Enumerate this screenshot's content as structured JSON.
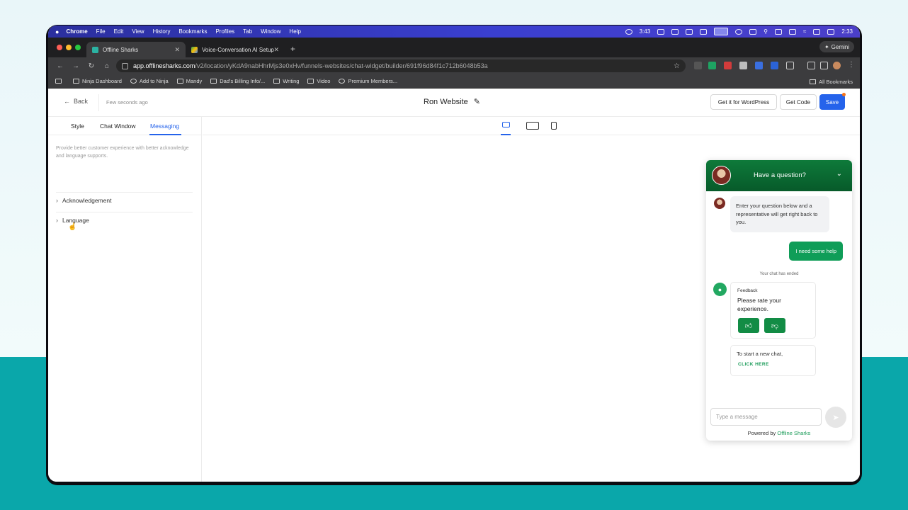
{
  "menubar": {
    "apple": "",
    "items": [
      "Chrome",
      "File",
      "Edit",
      "View",
      "History",
      "Bookmarks",
      "Profiles",
      "Tab",
      "Window",
      "Help"
    ],
    "timer": "3:43",
    "clock": "2:33"
  },
  "tabs": [
    {
      "title": "Offline Sharks",
      "active": true
    },
    {
      "title": "Voice-Conversation AI Setup",
      "active": false
    }
  ],
  "gemini_label": "Gemini",
  "address": {
    "host": "app.offlinesharks.com",
    "path": "/v2/location/yKdA9nabHhrMjs3e0xHv/funnels-websites/chat-widget/builder/691f96d84f1c712b6048b53a"
  },
  "bookmarks": [
    "Ninja Dashboard",
    "Add to Ninja",
    "Mandy",
    "Dad's Billing Info/...",
    "Writing",
    "Video",
    "Premium Members..."
  ],
  "all_bookmarks": "All Bookmarks",
  "header": {
    "back_label": "Back",
    "saved_status": "Few seconds ago",
    "site_name": "Ron Website",
    "wordpress_btn": "Get it for WordPress",
    "code_btn": "Get Code",
    "save_btn": "Save"
  },
  "sidebar": {
    "tabs": [
      "Style",
      "Chat Window",
      "Messaging"
    ],
    "active_tab": "Messaging",
    "description": "Provide better customer experience with better acknowledge and language supports.",
    "sections": [
      "Acknowledgement",
      "Language"
    ]
  },
  "widget": {
    "header_title": "Have a question?",
    "greeting": "Enter your question below and a representative will get right back to you.",
    "user_message": "I need some help",
    "ended_notice": "Your chat has ended",
    "feedback_label": "Feedback",
    "feedback_question": "Please rate your experience.",
    "new_chat_text": "To start a new chat,",
    "new_chat_link": "CLICK HERE",
    "input_placeholder": "Type a message",
    "powered_prefix": "Powered by",
    "powered_brand": "Offline Sharks",
    "brand_color": "#0f9d58"
  }
}
